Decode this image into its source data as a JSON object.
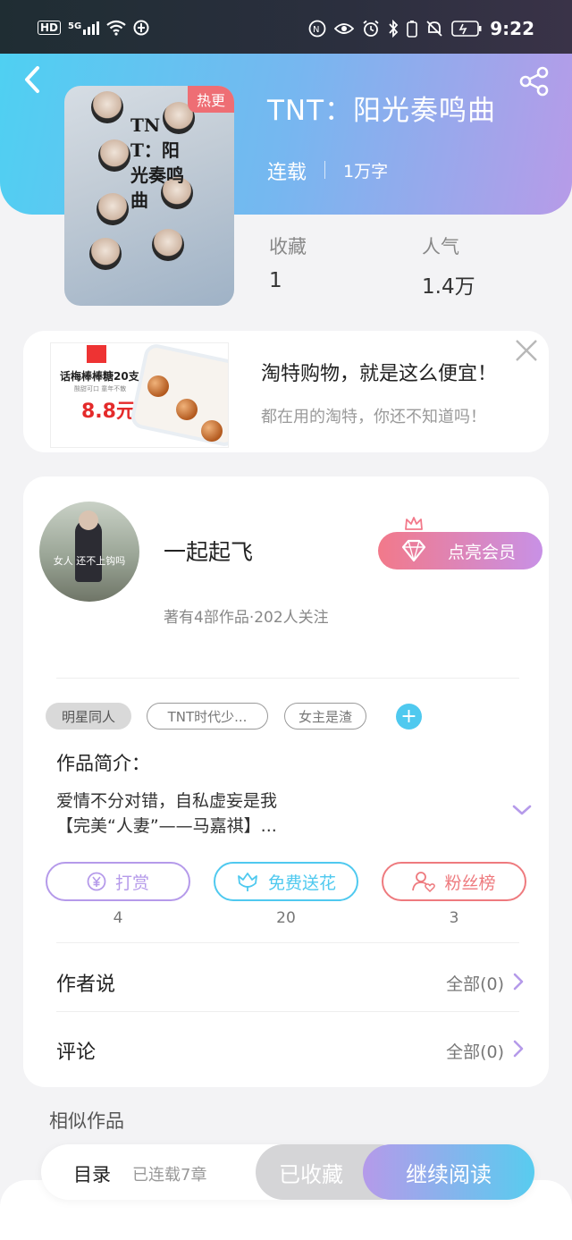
{
  "status_bar": {
    "left_icons": [
      "hd-icon",
      "5g-signal-icon",
      "wifi-icon",
      "vpn-icon"
    ],
    "right_icons": [
      "nfc-icon",
      "eye-icon",
      "alarm-icon",
      "bluetooth-icon",
      "mute-icon",
      "battery-icon"
    ],
    "hd": "HD",
    "net": "5G",
    "time": "9:22"
  },
  "header": {
    "back_icon": "chevron-left-icon",
    "share_icon": "share-icon"
  },
  "book": {
    "title": "TNT：阳光奏鸣曲",
    "status": "连载",
    "words": "1万字",
    "hot_badge": "热更",
    "cover_text": "TNT：阳光奏鸣曲",
    "stats": [
      {
        "label": "收藏",
        "value": "1"
      },
      {
        "label": "人气",
        "value": "1.4万"
      }
    ]
  },
  "ad": {
    "title": "淘特购物，就是这么便宜！",
    "subtitle": "都在用的淘特，你还不知道吗！",
    "image_title": "话梅棒棒糖20支",
    "image_sub": "酸甜可口 童年不散",
    "image_price": "8.8元",
    "close_icon": "close-icon"
  },
  "author": {
    "name": "一起起飞",
    "meta": "著有4部作品·202人关注",
    "avatar_caption": "女人 还不上钩吗",
    "vip_label": "点亮会员"
  },
  "tags": [
    "明星同人",
    "TNT时代少...",
    "女主是渣"
  ],
  "intro": {
    "label": "作品简介：",
    "lines": [
      "爱情不分对错，自私虚妄是我",
      "【完美“人妻”——马嘉祺】..."
    ]
  },
  "actions": [
    {
      "label": "打赏",
      "count": "4",
      "color": "#b59aea",
      "icon": "yen-coin-icon"
    },
    {
      "label": "免费送花",
      "count": "20",
      "color": "#4fc9ef",
      "icon": "flower-icon"
    },
    {
      "label": "粉丝榜",
      "count": "3",
      "color": "#ee7a7e",
      "icon": "fan-user-icon"
    }
  ],
  "rows": [
    {
      "label": "作者说",
      "right": "全部(0)"
    },
    {
      "label": "评论",
      "right": "全部(0)"
    }
  ],
  "similar_label": "相似作品",
  "bottom": {
    "toc_label": "目录",
    "toc_count": "已连载7章",
    "fav_label": "已收藏",
    "read_label": "继续阅读"
  },
  "colors": {
    "accent_cyan": "#4fc9ef",
    "accent_purple": "#b59aea",
    "hot_red": "#ee6e74"
  }
}
